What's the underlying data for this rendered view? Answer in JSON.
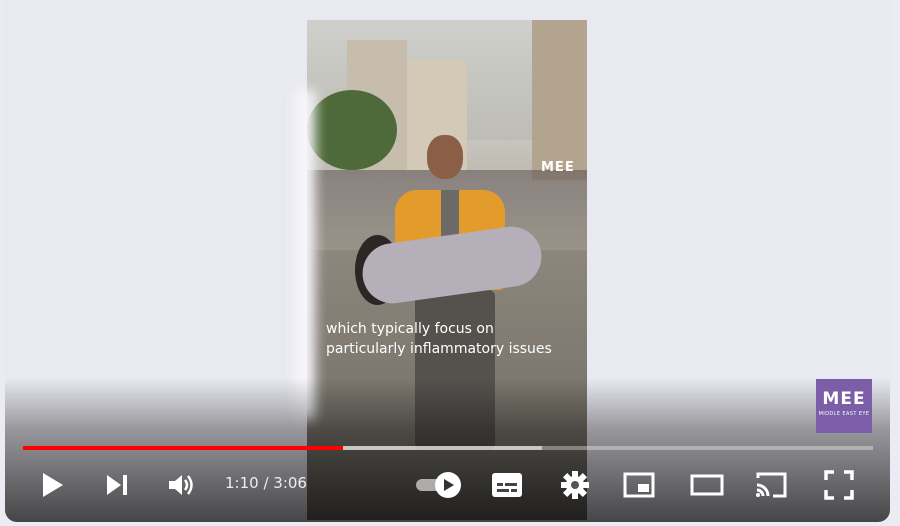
{
  "video": {
    "caption": "which typically focus on particularly inflammatory issues",
    "watermark_small": "MEE"
  },
  "branding": {
    "logo": "MEE",
    "logo_sub": "MIDDLE EAST EYE",
    "color": "#7b5ea7"
  },
  "player": {
    "time_current": "1:10",
    "time_sep": " / ",
    "time_total": "3:06",
    "progress": 0.376,
    "buffered": 0.61,
    "progress_color": "#ff0000"
  },
  "icons": [
    "play-icon",
    "next-icon",
    "volume-icon",
    "autoplay-toggle-icon",
    "subtitles-icon",
    "settings-icon",
    "miniplayer-icon",
    "theater-mode-icon",
    "cast-icon",
    "fullscreen-icon"
  ]
}
